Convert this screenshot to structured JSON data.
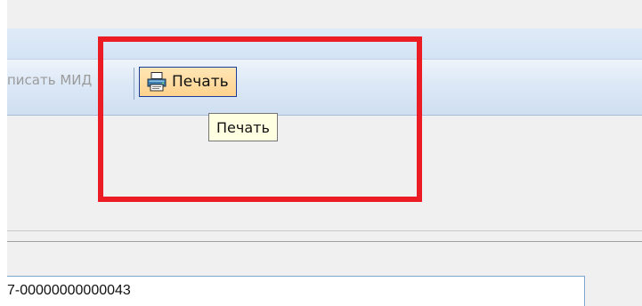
{
  "toolbar": {
    "sign_mid_label": "писать МИД",
    "print_label": "Печать"
  },
  "tooltip": {
    "text": "Печать"
  },
  "document": {
    "number_value": "7-00000000000043"
  },
  "colors": {
    "highlight_frame": "#ec1c24",
    "toolbar_bg": "#dce8f6",
    "hover_button_bg": "#ffd28e",
    "tooltip_bg": "#ffffe1"
  }
}
